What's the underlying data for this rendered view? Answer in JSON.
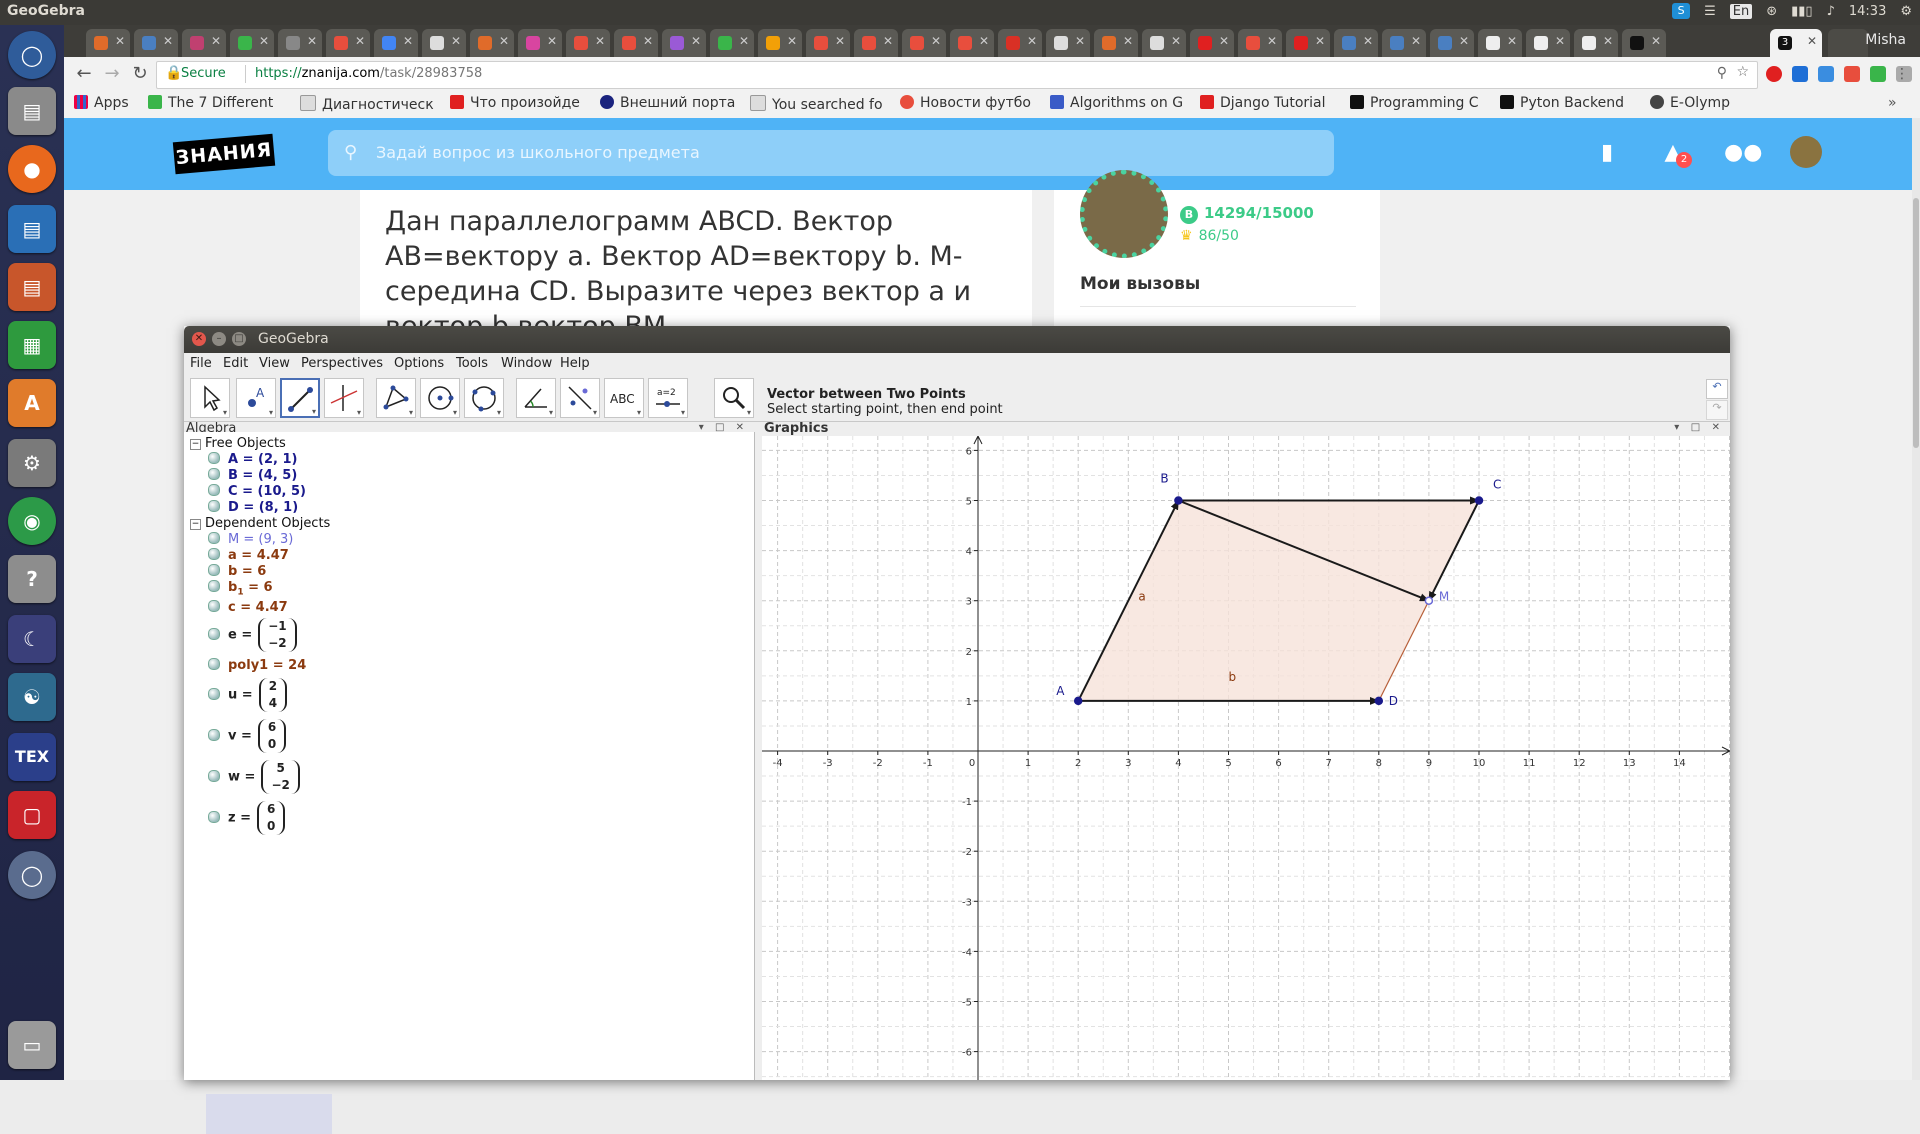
{
  "top_panel": {
    "title": "GeoGebra",
    "lang": "En",
    "clock": "14:33"
  },
  "browser": {
    "active_tab_favicon": "3",
    "user": "Misha",
    "omnibox": {
      "secure": "Secure",
      "scheme": "https://",
      "host": "znanija.com",
      "path": "/task/28983758"
    },
    "bookmarks": [
      "Apps",
      "The 7 Different",
      "Диагностическ",
      "Что произойде",
      "Внешний порта",
      "You searched fo",
      "Новости футбо",
      "Algorithms on G",
      "Django Tutorial",
      "Programming C",
      "Pyton Backend",
      "E-Olymp"
    ]
  },
  "site": {
    "logo": "ЗНАНИЯ",
    "search_placeholder": "Задай вопрос из школьного предмета",
    "notification_count": "2",
    "question": "Дан параллелограмм ABCD. Вектор AB=вектору а. Вектор AD=вектору b. М-середина CD. Выразите через вектор а и вектор b вектор ВМ.",
    "points": "14294/15000",
    "crowns": "86/50",
    "challenges_title": "Мои вызовы"
  },
  "geogebra": {
    "window_title": "GeoGebra",
    "menu": [
      "File",
      "Edit",
      "View",
      "Perspectives",
      "Options",
      "Tools",
      "Window",
      "Help"
    ],
    "tool_name": "Vector between Two Points",
    "tool_help": "Select starting point, then end point",
    "text_tool_label": "ABC",
    "slider_tool_label": "a=2",
    "algebra_title": "Algebra",
    "graphics_title": "Graphics",
    "free_label": "Free Objects",
    "free": [
      "A = (2, 1)",
      "B = (4, 5)",
      "C = (10, 5)",
      "D = (8, 1)"
    ],
    "dependent_label": "Dependent Objects",
    "dependent_simple": [
      "M = (9, 3)",
      "a = 4.47",
      "b = 6"
    ],
    "b1": {
      "base": "b",
      "sub": "1",
      "rest": " = 6"
    },
    "c": "c = 4.47",
    "e": {
      "name": "e =",
      "v1": "−1",
      "v2": "−2"
    },
    "poly": "poly1 = 24",
    "u": {
      "name": "u =",
      "v1": "2",
      "v2": "4"
    },
    "v": {
      "name": "v =",
      "v1": "6",
      "v2": "0"
    },
    "w": {
      "name": "w =",
      "v1": "5",
      "v2": "−2"
    },
    "z": {
      "name": "z =",
      "v1": "6",
      "v2": "0"
    }
  },
  "chart_data": {
    "type": "scatter",
    "xlim": [
      -4,
      14
    ],
    "ylim": [
      -6,
      6
    ],
    "grid": true,
    "points": [
      {
        "label": "A",
        "x": 2,
        "y": 1
      },
      {
        "label": "B",
        "x": 4,
        "y": 5
      },
      {
        "label": "C",
        "x": 10,
        "y": 5
      },
      {
        "label": "D",
        "x": 8,
        "y": 1
      },
      {
        "label": "M",
        "x": 9,
        "y": 3
      }
    ],
    "segment_labels": [
      {
        "text": "a",
        "x": 3.2,
        "y": 3
      },
      {
        "text": "b",
        "x": 5,
        "y": 1.4
      }
    ],
    "vectors": [
      {
        "from": [
          2,
          1
        ],
        "to": [
          4,
          5
        ]
      },
      {
        "from": [
          2,
          1
        ],
        "to": [
          8,
          1
        ]
      },
      {
        "from": [
          10,
          5
        ],
        "to": [
          9,
          3
        ]
      },
      {
        "from": [
          4,
          5
        ],
        "to": [
          10,
          5
        ]
      },
      {
        "from": [
          4,
          5
        ],
        "to": [
          9,
          3
        ]
      }
    ],
    "polygon": [
      [
        2,
        1
      ],
      [
        4,
        5
      ],
      [
        10,
        5
      ],
      [
        8,
        1
      ]
    ],
    "colors": {
      "fill": "#f6e2da",
      "edge": "#b8603a",
      "vector": "#1a1a1a",
      "point": "#1a1a8c",
      "label": "#1a1a8c",
      "m_label": "#6a6ad6",
      "segment_label": "#8b3a0f"
    }
  }
}
